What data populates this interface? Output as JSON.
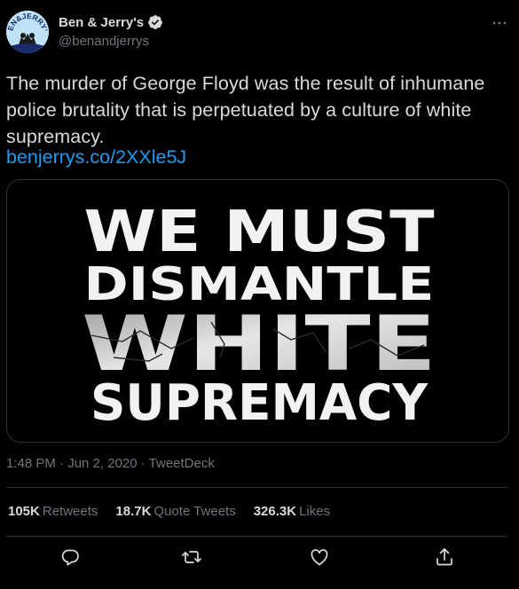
{
  "author": {
    "display_name": "Ben & Jerry's",
    "handle": "@benandjerrys",
    "avatar_text": "BEN&JERRY'S",
    "verified_icon": "verified-badge-icon"
  },
  "tweet": {
    "text": "The murder of George Floyd was the result of inhumane police brutality that is perpetuated by a culture of white supremacy.",
    "link": "benjerrys.co/2XXle5J"
  },
  "media": {
    "lines": [
      "WE MUST",
      "DISMANTLE",
      "WHITE",
      "SUPREMACY"
    ]
  },
  "meta": {
    "timestamp": "1:48 PM · Jun 2, 2020 · TweetDeck"
  },
  "stats": {
    "retweets_count": "105K",
    "retweets_label": "Retweets",
    "quotes_count": "18.7K",
    "quotes_label": "Quote Tweets",
    "likes_count": "326.3K",
    "likes_label": "Likes"
  },
  "actions": [
    "reply-icon",
    "retweet-icon",
    "like-icon",
    "share-icon"
  ],
  "colors": {
    "background": "#000000",
    "text": "#d9d9d9",
    "muted": "#6e767d",
    "link": "#1d9bf0",
    "border": "#2f3336"
  }
}
